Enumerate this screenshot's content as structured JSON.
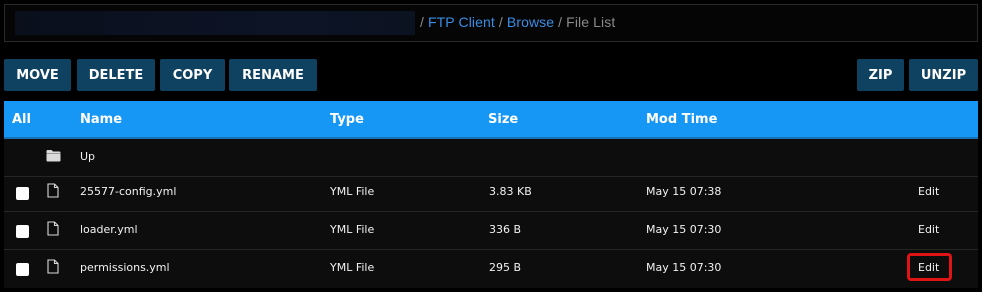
{
  "breadcrumb": {
    "items": [
      {
        "label": "FTP Client",
        "link": true
      },
      {
        "label": "Browse",
        "link": true
      },
      {
        "label": "File List",
        "link": false
      }
    ],
    "separator": "/"
  },
  "toolbar": {
    "move_label": "MOVE",
    "delete_label": "DELETE",
    "copy_label": "COPY",
    "rename_label": "RENAME",
    "zip_label": "ZIP",
    "unzip_label": "UNZIP"
  },
  "table": {
    "headers": {
      "select_all": "All",
      "name": "Name",
      "type": "Type",
      "size": "Size",
      "mod_time": "Mod Time"
    },
    "up_row": {
      "label": "Up",
      "icon": "folder-icon"
    },
    "rows": [
      {
        "name": "25577-config.yml",
        "type": "YML File",
        "size": "3.83 KB",
        "mod_time": "May 15 07:38",
        "action": "Edit",
        "icon": "file-icon"
      },
      {
        "name": "loader.yml",
        "type": "YML File",
        "size": "336 B",
        "mod_time": "May 15 07:30",
        "action": "Edit",
        "icon": "file-icon"
      },
      {
        "name": "permissions.yml",
        "type": "YML File",
        "size": "295 B",
        "mod_time": "May 15 07:30",
        "action": "Edit",
        "icon": "file-icon",
        "highlighted": true
      }
    ]
  },
  "colors": {
    "button_bg": "#0f4161",
    "header_bg": "#1797f5",
    "link": "#3a8ee6",
    "highlight": "#e01414"
  }
}
